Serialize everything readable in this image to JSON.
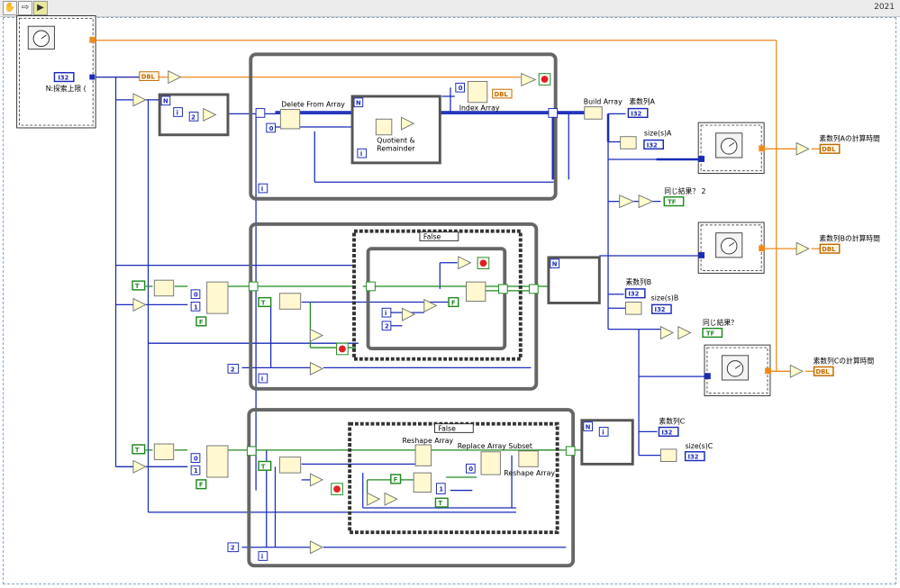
{
  "toolbar": {
    "year": "2021",
    "buttons": [
      {
        "icon": "hand-tool-icon"
      },
      {
        "icon": "arrow-right-icon"
      },
      {
        "icon": "run-icon"
      }
    ]
  },
  "diagram": {
    "n_label": "N:探索上限 (",
    "type_labels": {
      "i32": "I32",
      "dbl": "DBL",
      "tf": "TF"
    },
    "loop_labels": {
      "n": "N",
      "i": "i"
    },
    "case_selector": "False",
    "constants": {
      "zero": "0",
      "one": "1",
      "two": "2",
      "f": "F",
      "t": "T"
    },
    "functions": {
      "delete_from_array": "Delete From Array",
      "quotient_remainder_line1": "Quotient &",
      "quotient_remainder_line2": "Remainder",
      "index_array": "Index Array",
      "build_array": "Build Array",
      "reshape_array_top": "Reshape Array",
      "replace_array_subset": "Replace Array Subset",
      "reshape_array_bottom": "Reshape Array"
    },
    "indicators": {
      "primes_a": "素数列A",
      "size_a": "size(s)A",
      "same_result_2": "同じ結果？ 2",
      "primes_b": "素数列B",
      "size_b": "size(s)B",
      "same_result": "同じ結果？",
      "primes_c": "素数列C",
      "size_c": "size(s)C",
      "time_a": "素数列Aの計算時間",
      "time_b": "素数列Bの計算時間",
      "time_c": "素数列Cの計算時間"
    }
  }
}
